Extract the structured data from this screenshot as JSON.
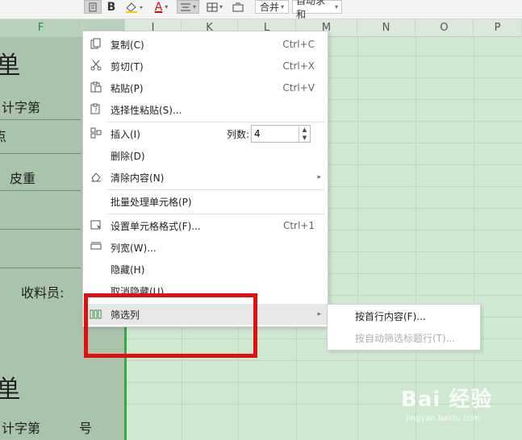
{
  "toolbar": {
    "merge_label": "合并",
    "autosum_label": "自动求和",
    "bold_label": "B",
    "font_color_label": "A"
  },
  "columns": [
    "F",
    "J",
    "K",
    "L",
    "M",
    "N",
    "O",
    "P"
  ],
  "sheet_text": {
    "title_top": "单",
    "jizi_top": "计字第",
    "row_cut": "点",
    "tare": "皮重",
    "receiver": "收料员:",
    "title_bottom": "单",
    "jizi_bottom": "计字第",
    "hao": "号"
  },
  "context_menu": {
    "items": [
      {
        "icon": "copy-icon",
        "label": "复制(C)",
        "shortcut": "Ctrl+C"
      },
      {
        "icon": "cut-icon",
        "label": "剪切(T)",
        "shortcut": "Ctrl+X"
      },
      {
        "icon": "paste-icon",
        "label": "粘贴(P)",
        "shortcut": "Ctrl+V"
      },
      {
        "icon": "paste-special-icon",
        "label": "选择性粘贴(S)...",
        "shortcut": ""
      },
      {
        "icon": "insert-column-icon",
        "label": "插入(I)",
        "shortcut": ""
      },
      {
        "icon": "",
        "label": "删除(D)",
        "shortcut": ""
      },
      {
        "icon": "eraser-icon",
        "label": "清除内容(N)",
        "shortcut": ""
      },
      {
        "icon": "",
        "label": "批量处理单元格(P)",
        "shortcut": ""
      },
      {
        "icon": "format-cells-icon",
        "label": "设置单元格格式(F)...",
        "shortcut": "Ctrl+1"
      },
      {
        "icon": "column-width-icon",
        "label": "列宽(W)...",
        "shortcut": ""
      },
      {
        "icon": "",
        "label": "隐藏(H)",
        "shortcut": ""
      },
      {
        "icon": "",
        "label": "取消隐藏(U)",
        "shortcut": ""
      },
      {
        "icon": "filter-column-icon",
        "label": "筛选列",
        "shortcut": ""
      }
    ],
    "column_count_label": "列数:",
    "column_count_value": "4"
  },
  "submenu": {
    "items": [
      {
        "label": "按首行内容(F)...",
        "enabled": true
      },
      {
        "label": "按自动筛选标题行(T)...",
        "enabled": false
      }
    ]
  },
  "watermark": {
    "logo": "Bai 经验",
    "url": "jingyan.baidu.com"
  },
  "colors": {
    "sheet_bg": "#cfe8d0",
    "selected_cols_bg": "#a9c4ab",
    "selection_border": "#3aa64a",
    "annotation_red": "#e01010",
    "menu_hover": "#e7e7e7"
  }
}
